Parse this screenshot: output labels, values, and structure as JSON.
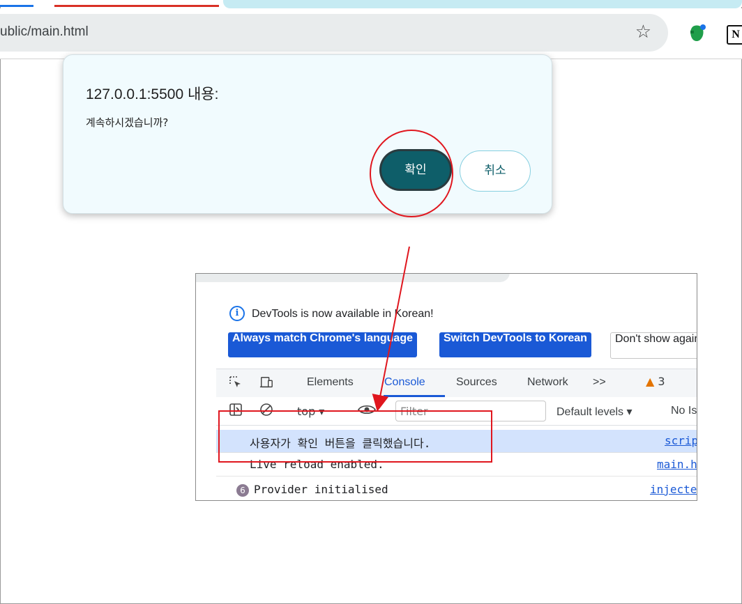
{
  "browser": {
    "url": "ublic/main.html",
    "bookmark_icon": "star-icon",
    "extensions": [
      "evernote-icon",
      "notion-icon"
    ],
    "notion_letter": "N"
  },
  "dialog": {
    "title": "127.0.0.1:5500 내용:",
    "message": "계속하시겠습니까?",
    "ok_label": "확인",
    "cancel_label": "취소"
  },
  "devtools": {
    "notice": "DevTools is now available in Korean!",
    "chips": [
      "Always match Chrome's language",
      "Switch DevTools to Korean",
      "Don't show again"
    ],
    "tabs": [
      "Elements",
      "Console",
      "Sources",
      "Network"
    ],
    "more_tabs": ">>",
    "active_tab": "Console",
    "warning_count": "3",
    "context": "top",
    "filter_placeholder": "Filter",
    "levels": "Default levels",
    "issues": "No Issues",
    "logs": [
      {
        "message": "사용자가 확인 버튼을 클릭했습니다.",
        "source": "script.js"
      },
      {
        "message": "Live reload enabled.",
        "source": "main.html"
      },
      {
        "count": "6",
        "message": "Provider initialised",
        "source": "injected.js"
      }
    ]
  },
  "colors": {
    "ok_button": "#0e5e69",
    "link_blue": "#1a59d6",
    "annotation_red": "#e0161e",
    "dialog_bg": "#f1fbfe"
  }
}
